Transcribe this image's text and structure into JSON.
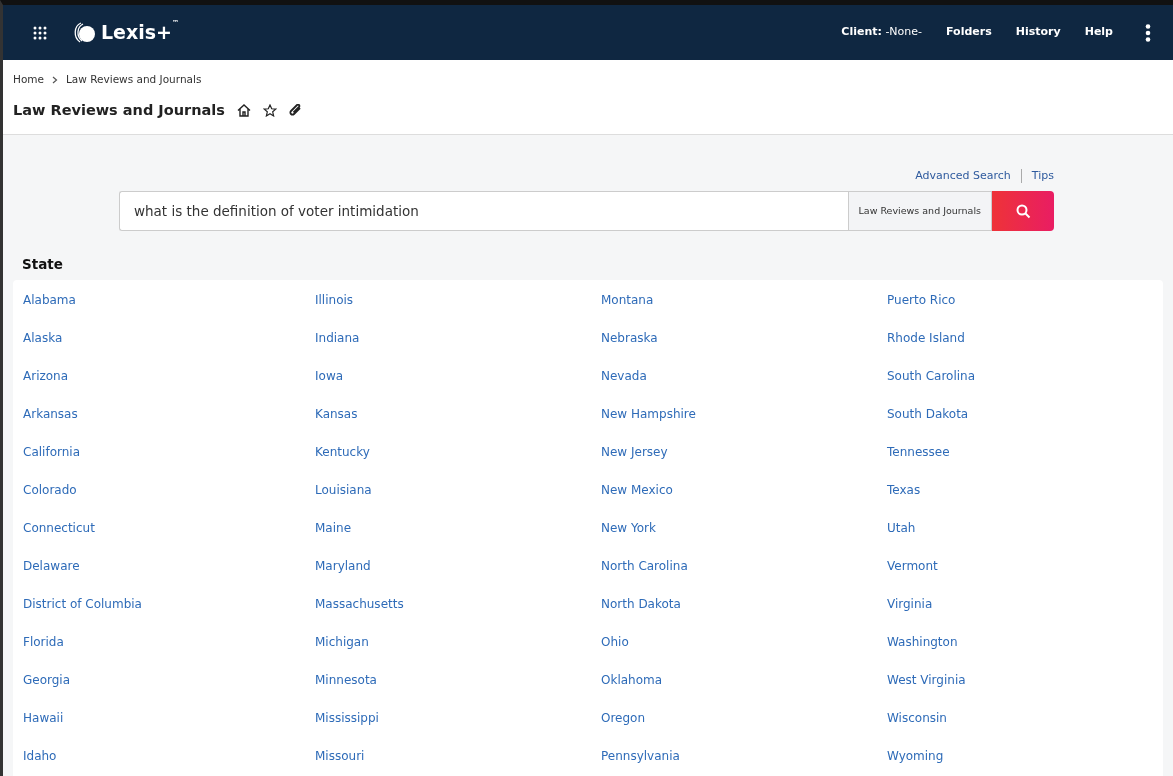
{
  "header": {
    "brand": "Lexis+",
    "trademark": "™",
    "client_label": "Client:",
    "client_value": "-None-",
    "links": [
      "Folders",
      "History",
      "Help"
    ]
  },
  "breadcrumb": [
    "Home",
    "Law Reviews and Journals"
  ],
  "page_title": "Law Reviews and Journals",
  "search": {
    "links": [
      "Advanced Search",
      "Tips"
    ],
    "value": "what is the definition of voter intimidation",
    "source": "Law Reviews and Journals"
  },
  "state_heading": "State",
  "state_columns": [
    [
      "Alabama",
      "Alaska",
      "Arizona",
      "Arkansas",
      "California",
      "Colorado",
      "Connecticut",
      "Delaware",
      "District of Columbia",
      "Florida",
      "Georgia",
      "Hawaii",
      "Idaho"
    ],
    [
      "Illinois",
      "Indiana",
      "Iowa",
      "Kansas",
      "Kentucky",
      "Louisiana",
      "Maine",
      "Maryland",
      "Massachusetts",
      "Michigan",
      "Minnesota",
      "Mississippi",
      "Missouri"
    ],
    [
      "Montana",
      "Nebraska",
      "Nevada",
      "New Hampshire",
      "New Jersey",
      "New Mexico",
      "New York",
      "North Carolina",
      "North Dakota",
      "Ohio",
      "Oklahoma",
      "Oregon",
      "Pennsylvania"
    ],
    [
      "Puerto Rico",
      "Rhode Island",
      "South Carolina",
      "South Dakota",
      "Tennessee",
      "Texas",
      "Utah",
      "Vermont",
      "Virginia",
      "Washington",
      "West Virginia",
      "Wisconsin",
      "Wyoming"
    ]
  ]
}
